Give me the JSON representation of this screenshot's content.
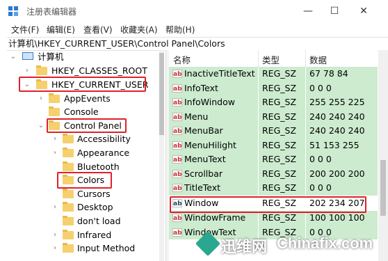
{
  "window": {
    "title": "注册表编辑器",
    "min": "—",
    "max": "☐",
    "close": "✕"
  },
  "menu": [
    "文件(F)",
    "编辑(E)",
    "查看(V)",
    "收藏夹(A)",
    "帮助(H)"
  ],
  "address": "计算机\\HKEY_CURRENT_USER\\Control Panel\\Colors",
  "tree": [
    {
      "label": "计算机",
      "level": 0,
      "chevron": "⌄",
      "icon": "computer-icon"
    },
    {
      "label": "HKEY_CLASSES_ROOT",
      "level": 1,
      "chevron": "›"
    },
    {
      "label": "HKEY_CURRENT_USER",
      "level": 1,
      "chevron": "⌄"
    },
    {
      "label": "AppEvents",
      "level": 2,
      "chevron": "›"
    },
    {
      "label": "Console",
      "level": 2,
      "chevron": ""
    },
    {
      "label": "Control Panel",
      "level": 2,
      "chevron": "⌄"
    },
    {
      "label": "Accessibility",
      "level": 3,
      "chevron": "›"
    },
    {
      "label": "Appearance",
      "level": 3,
      "chevron": "›"
    },
    {
      "label": "Bluetooth",
      "level": 3,
      "chevron": ""
    },
    {
      "label": "Colors",
      "level": 3,
      "chevron": "",
      "selected": true
    },
    {
      "label": "Cursors",
      "level": 3,
      "chevron": ""
    },
    {
      "label": "Desktop",
      "level": 3,
      "chevron": "›"
    },
    {
      "label": "don't load",
      "level": 3,
      "chevron": ""
    },
    {
      "label": "Infrared",
      "level": 3,
      "chevron": "›"
    },
    {
      "label": "Input Method",
      "level": 3,
      "chevron": "›"
    }
  ],
  "list": {
    "headers": {
      "name": "名称",
      "type": "类型",
      "data": "数据"
    },
    "rows": [
      {
        "name": "InactiveTitleText",
        "type": "REG_SZ",
        "data": "67 78 84"
      },
      {
        "name": "InfoText",
        "type": "REG_SZ",
        "data": "0 0 0"
      },
      {
        "name": "InfoWindow",
        "type": "REG_SZ",
        "data": "255 255 225"
      },
      {
        "name": "Menu",
        "type": "REG_SZ",
        "data": "240 240 240"
      },
      {
        "name": "MenuBar",
        "type": "REG_SZ",
        "data": "240 240 240"
      },
      {
        "name": "MenuHilight",
        "type": "REG_SZ",
        "data": "51 153 255"
      },
      {
        "name": "MenuText",
        "type": "REG_SZ",
        "data": "0 0 0"
      },
      {
        "name": "Scrollbar",
        "type": "REG_SZ",
        "data": "200 200 200"
      },
      {
        "name": "TitleText",
        "type": "REG_SZ",
        "data": "0 0 0"
      },
      {
        "name": "Window",
        "type": "REG_SZ",
        "data": "202 234 207",
        "highlighted": true
      },
      {
        "name": "WindowFrame",
        "type": "REG_SZ",
        "data": "100 100 100"
      },
      {
        "name": "WindowText",
        "type": "REG_SZ",
        "data": "0 0 0"
      }
    ]
  },
  "watermark": {
    "cn": "迅维网",
    "en": "Chinafix.com"
  },
  "colors": {
    "row_green": "#ccebcf",
    "highlight_red": "#e0202a",
    "folder": "#f6d06e"
  }
}
